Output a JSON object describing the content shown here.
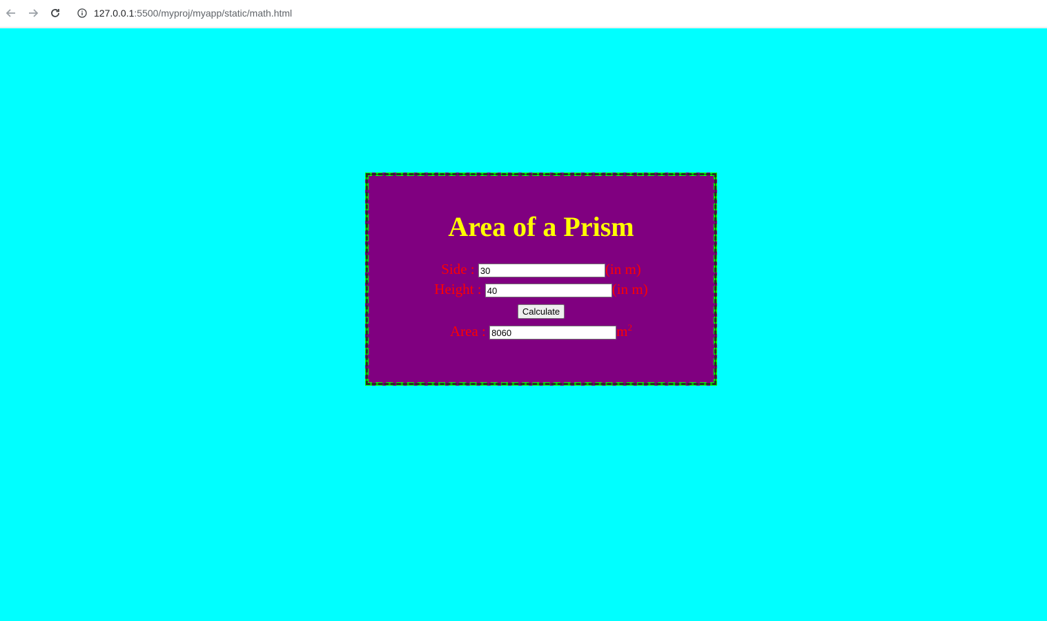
{
  "browser": {
    "url_host": "127.0.0.1",
    "url_rest": ":5500/myproj/myapp/static/math.html",
    "icons": [
      "back-arrow-icon",
      "forward-arrow-icon",
      "reload-icon",
      "info-icon"
    ]
  },
  "colors": {
    "page_background": "#00ffff",
    "card_background": "#800080",
    "card_border": "#00ff00",
    "title_color": "#ffff00",
    "label_color": "#ff0000"
  },
  "form": {
    "title": "Area of a Prism",
    "side_label": "Side :",
    "side_value": "30",
    "side_unit": "(in m)",
    "height_label": "Height :",
    "height_value": "40",
    "height_unit": "(in m)",
    "calculate_label": "Calculate",
    "area_label": "Area :",
    "area_value": "8060",
    "area_unit": "m",
    "area_unit_sup": "2"
  }
}
